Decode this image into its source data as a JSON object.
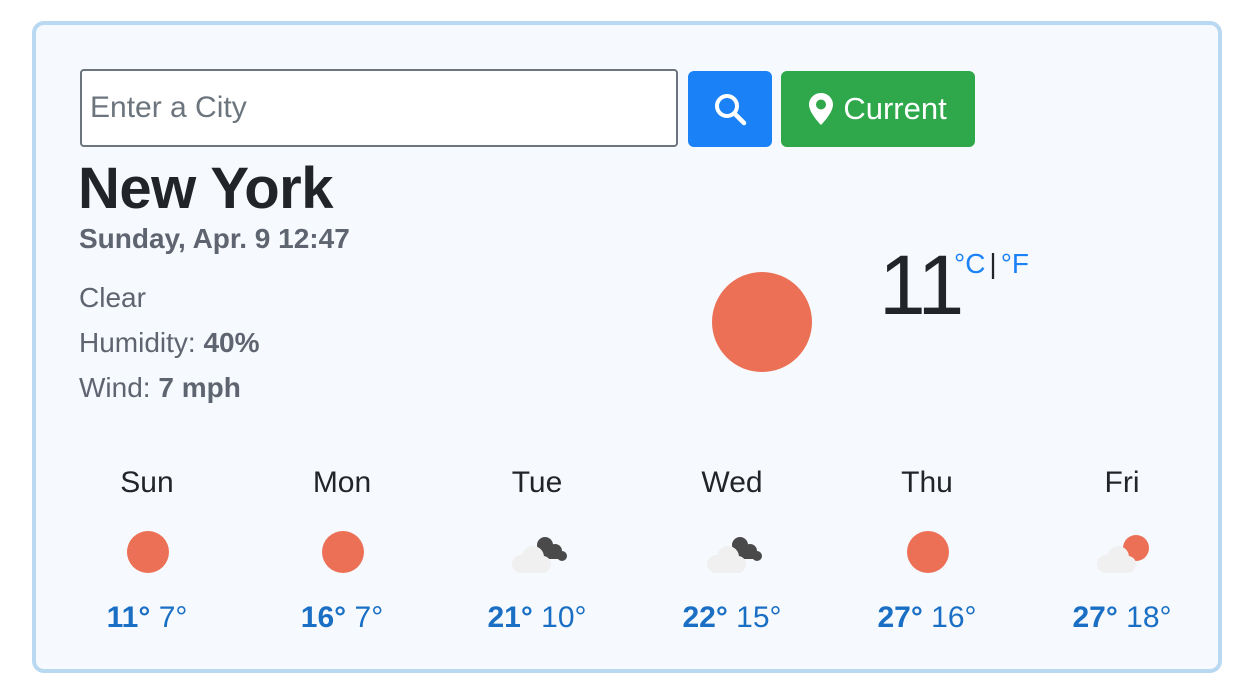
{
  "search": {
    "placeholder": "Enter a City",
    "current_label": "Current"
  },
  "location": {
    "city": "New York",
    "datetime": "Sunday, Apr. 9 12:47",
    "condition": "Clear",
    "humidity_label": "Humidity: ",
    "humidity_value": "40%",
    "wind_label": "Wind: ",
    "wind_value": "7 mph"
  },
  "current": {
    "temperature": "11",
    "icon": "sun-icon",
    "unit_c": "°C",
    "unit_sep": "|",
    "unit_f": "°F"
  },
  "forecast": [
    {
      "day": "Sun",
      "high": "11°",
      "low": "7°",
      "icon": "sun-icon"
    },
    {
      "day": "Mon",
      "high": "16°",
      "low": "7°",
      "icon": "sun-icon"
    },
    {
      "day": "Tue",
      "high": "21°",
      "low": "10°",
      "icon": "clouds-icon"
    },
    {
      "day": "Wed",
      "high": "22°",
      "low": "15°",
      "icon": "clouds-icon"
    },
    {
      "day": "Thu",
      "high": "27°",
      "low": "16°",
      "icon": "sun-icon"
    },
    {
      "day": "Fri",
      "high": "27°",
      "low": "18°",
      "icon": "partly-cloudy-icon"
    }
  ],
  "colors": {
    "accent": "#1a82f6",
    "success": "#2ea84a",
    "sun": "#eb7055",
    "temps": "#1a6fc4",
    "card_border": "#b9d8f2",
    "card_bg": "#f6fafe"
  }
}
